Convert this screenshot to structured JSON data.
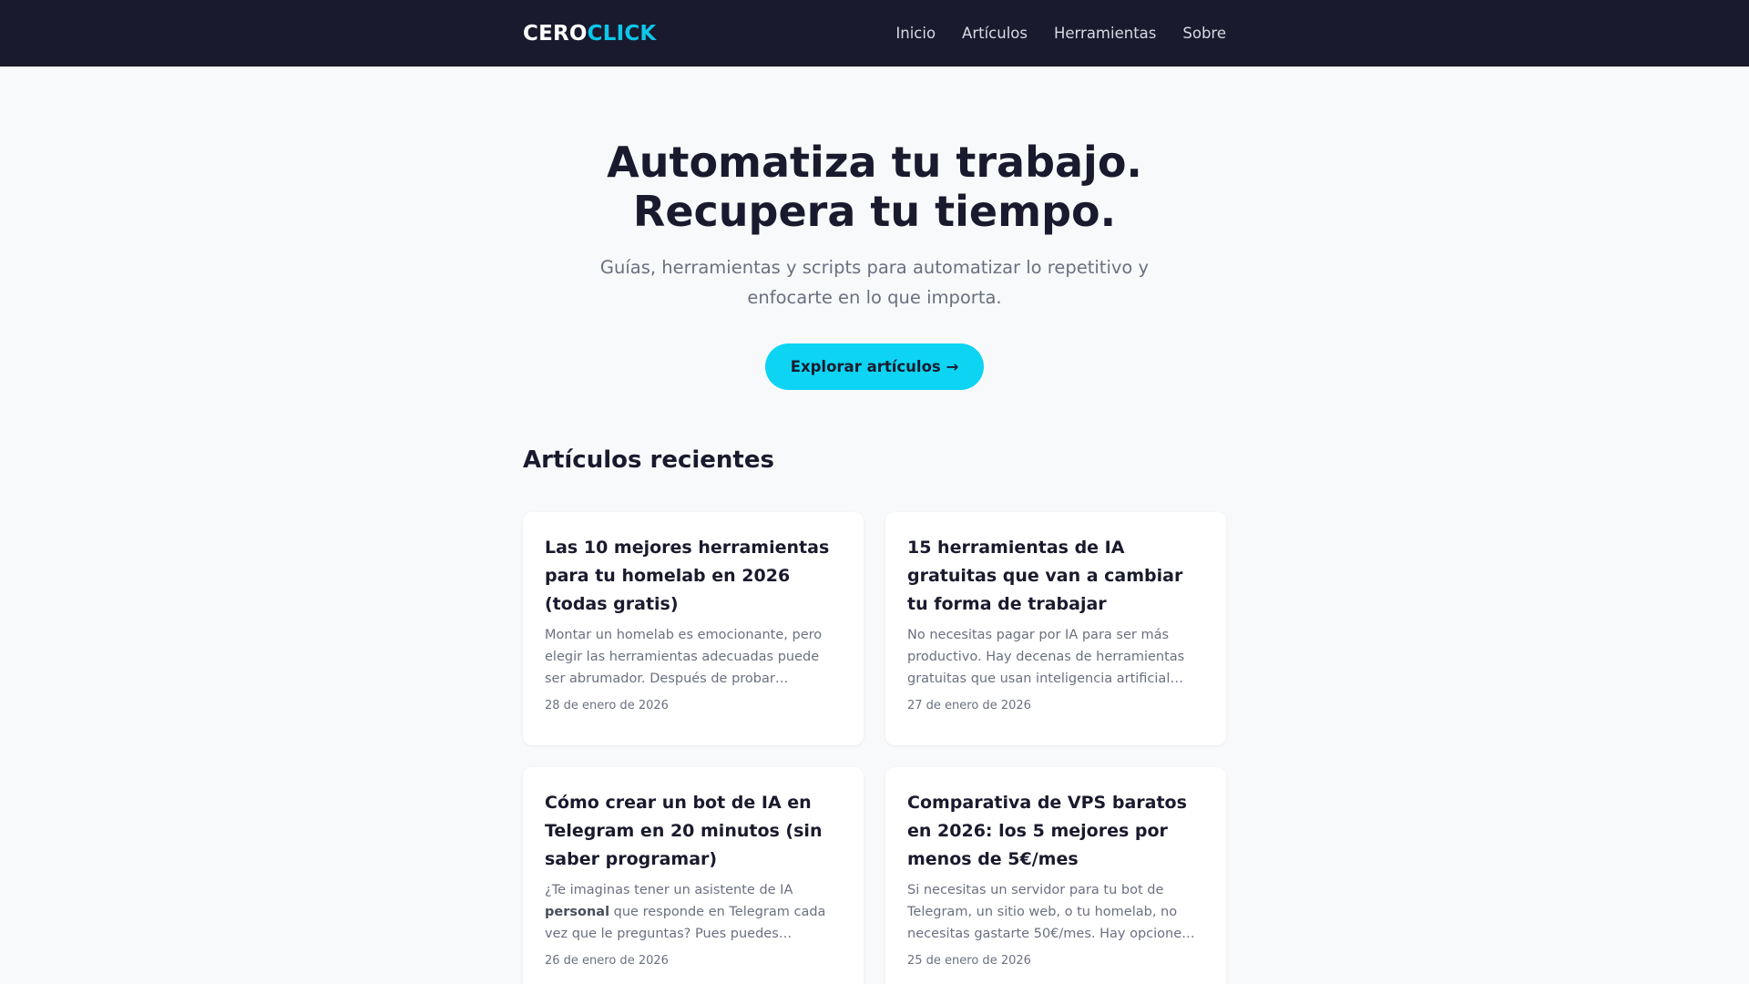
{
  "header": {
    "logo_part1": "CERO",
    "logo_part2": "CLICK",
    "nav": [
      "Inicio",
      "Artículos",
      "Herramientas",
      "Sobre"
    ]
  },
  "hero": {
    "title_line1": "Automatiza tu trabajo.",
    "title_line2": "Recupera tu tiempo.",
    "subtitle": "Guías, herramientas y scripts para automatizar lo repetitivo y enfocarte en lo que importa.",
    "cta": "Explorar artículos →"
  },
  "recent": {
    "heading": "Artículos recientes",
    "articles": [
      {
        "title": "Las 10 mejores herramientas para tu homelab en 2026 (todas gratis)",
        "excerpt": "Montar un homelab es emocionante, pero elegir las herramientas adecuadas puede ser abrumador. Después de probar…",
        "date": "28 de enero de 2026"
      },
      {
        "title": "15 herramientas de IA gratuitas que van a cambiar tu forma de trabajar",
        "excerpt": "No necesitas pagar por IA para ser más productivo. Hay decenas de herramientas gratuitas que usan inteligencia artificial…",
        "date": "27 de enero de 2026"
      },
      {
        "title": "Cómo crear un bot de IA en Telegram en 20 minutos (sin saber programar)",
        "excerpt_pre": "¿Te imaginas tener un asistente de IA ",
        "excerpt_bold": "personal",
        "excerpt_post": " que responde en Telegram cada vez que le preguntas? Pues puedes…",
        "date": "26 de enero de 2026"
      },
      {
        "title": "Comparativa de VPS baratos en 2026: los 5 mejores por menos de 5€/mes",
        "excerpt": "Si necesitas un servidor para tu bot de Telegram, un sitio web, o tu homelab, no necesitas gastarte 50€/mes. Hay opcione…",
        "date": "25 de enero de 2026"
      }
    ]
  }
}
